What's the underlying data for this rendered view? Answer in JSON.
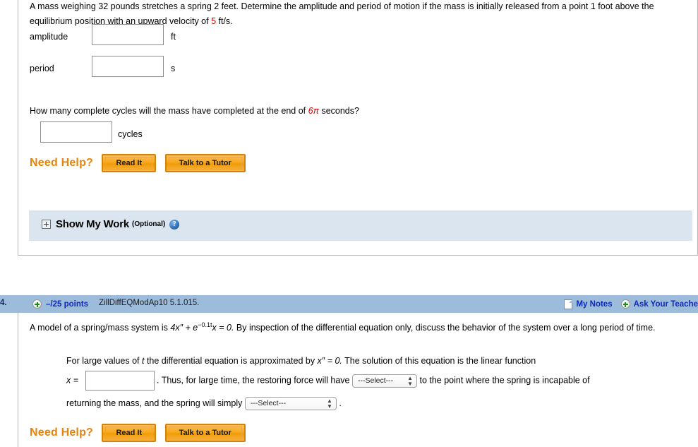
{
  "question_top": {
    "stem_part1": "A mass weighing 32 pounds stretches a spring 2 feet. Determine the amplitude and period of motion if the mass is initially released from a point 1 foot above the equilibrium position with an upward velocity of ",
    "stem_value": "5",
    "stem_part2": " ft/s.",
    "fields": [
      {
        "label": "amplitude",
        "value": "",
        "unit": "ft"
      },
      {
        "label": "period",
        "value": "",
        "unit": "s"
      }
    ],
    "cycles_question_part1": "How many complete cycles will the mass have completed at the end of ",
    "cycles_question_value": "6π",
    "cycles_question_part2": " seconds?",
    "cycles_field": {
      "value": "",
      "unit": "cycles"
    },
    "need_help": {
      "label": "Need Help?",
      "read_it": "Read It",
      "talk_to_tutor": "Talk to a Tutor"
    },
    "show_my_work": {
      "title": "Show My Work",
      "optional": "(Optional)",
      "help_glyph": "?",
      "expand_icon": "plus-square-icon"
    }
  },
  "question_bottom": {
    "header": {
      "number": "4.",
      "points": "–/25 points",
      "code": "ZillDiffEQModAp10 5.1.015.",
      "my_notes": "My Notes",
      "ask_your_teacher": "Ask Your Teache",
      "plus_icon": "plus-circle-icon",
      "note_icon": "note-page-icon"
    },
    "stem_pre": "A model of a spring/mass system is ",
    "eq_a": "4x″ + e",
    "eq_exp": "−0.1t",
    "eq_b": "x = 0.",
    "stem_post": "  By inspection of the differential equation only, discuss the behavior of the system over a long period of time.",
    "line2_pre": "For large values of ",
    "line2_var": "t",
    "line2_mid": " the differential equation is approximated by  ",
    "line2_eq": "x″ = 0.",
    "line2_post": "  The solution of this equation is the linear function",
    "line3_label": "x =",
    "line3_input": "",
    "line3_mid": ".  Thus, for large time, the restoring force will have",
    "select1": "---Select---",
    "line3_post": "to the point where the spring is incapable of",
    "line4_pre": "returning the mass, and the spring will simply",
    "select2": "---Select---",
    "line4_post": ".",
    "need_help": {
      "label": "Need Help?",
      "read_it": "Read It",
      "talk_to_tutor": "Talk to a Tutor"
    }
  }
}
